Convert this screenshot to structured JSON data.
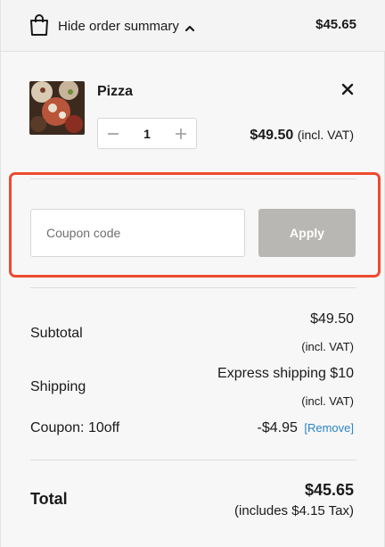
{
  "header": {
    "toggle_label": "Hide order summary",
    "total": "$45.65",
    "icon": "shopping-bag-icon"
  },
  "cart": {
    "items": [
      {
        "name": "Pizza",
        "quantity": "1",
        "price": "$49.50",
        "price_note": "(incl. VAT)"
      }
    ]
  },
  "coupon": {
    "placeholder": "Coupon code",
    "value": "",
    "apply_label": "Apply"
  },
  "totals": {
    "subtotal_label": "Subtotal",
    "subtotal_value": "$49.50",
    "subtotal_note": "(incl. VAT)",
    "shipping_label": "Shipping",
    "shipping_value": "Express shipping $10",
    "shipping_note": "(incl. VAT)",
    "coupon_label": "Coupon: 10off",
    "coupon_value": "-$4.95",
    "coupon_remove": "[Remove]",
    "total_label": "Total",
    "total_value": "$45.65",
    "tax_note": "(includes $4.15 Tax)"
  },
  "colors": {
    "highlight_border": "#ee4a2f",
    "apply_button_bg": "#b9b7b3",
    "remove_link": "#2a84c6"
  }
}
